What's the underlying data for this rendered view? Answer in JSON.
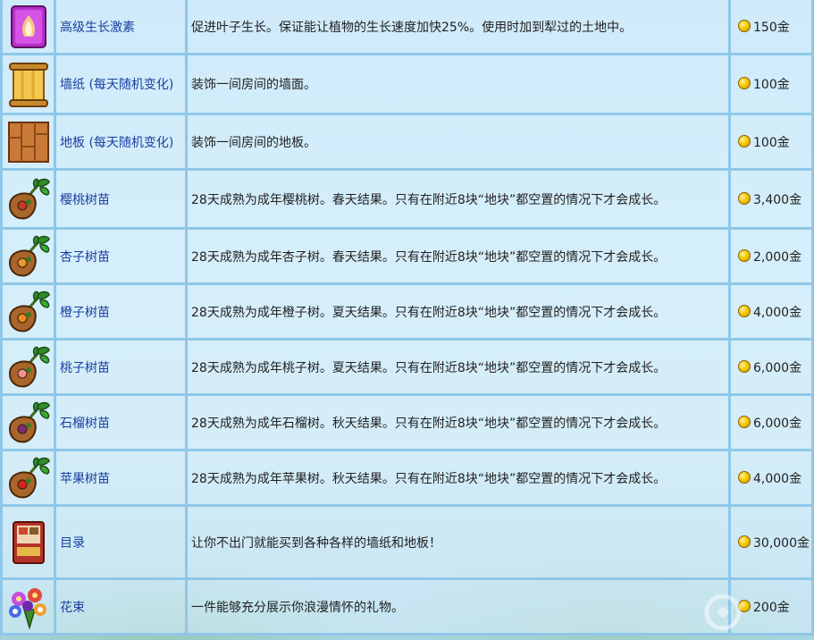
{
  "currency": "金",
  "rows": [
    {
      "icon": "deluxe-speed-gro-icon",
      "name": "高级生长激素",
      "desc": "促进叶子生长。保证能让植物的生长速度加快25%。使用时加到犁过的土地中。",
      "price": "150金"
    },
    {
      "icon": "wallpaper-scroll-icon",
      "name": "墙纸 (每天随机变化)",
      "desc": "装饰一间房间的墙面。",
      "price": "100金"
    },
    {
      "icon": "flooring-tile-icon",
      "name": "地板 (每天随机变化)",
      "desc": "装饰一间房间的地板。",
      "price": "100金"
    },
    {
      "icon": "sapling-icon",
      "name": "樱桃树苗",
      "desc": "28天成熟为成年樱桃树。春天结果。只有在附近8块“地块”都空置的情况下才会成长。",
      "price": "3,400金",
      "fruit": "#c0392b"
    },
    {
      "icon": "sapling-icon",
      "name": "杏子树苗",
      "desc": "28天成熟为成年杏子树。春天结果。只有在附近8块“地块”都空置的情况下才会成长。",
      "price": "2,000金",
      "fruit": "#e59b2e"
    },
    {
      "icon": "sapling-icon",
      "name": "橙子树苗",
      "desc": "28天成熟为成年橙子树。夏天结果。只有在附近8块“地块”都空置的情况下才会成长。",
      "price": "4,000金",
      "fruit": "#f08a1c"
    },
    {
      "icon": "sapling-icon",
      "name": "桃子树苗",
      "desc": "28天成熟为成年桃子树。夏天结果。只有在附近8块“地块”都空置的情况下才会成长。",
      "price": "6,000金",
      "fruit": "#f2918c"
    },
    {
      "icon": "sapling-icon",
      "name": "石榴树苗",
      "desc": "28天成熟为成年石榴树。秋天结果。只有在附近8块“地块”都空置的情况下才会成长。",
      "price": "6,000金",
      "fruit": "#7b2a7a"
    },
    {
      "icon": "sapling-icon",
      "name": "苹果树苗",
      "desc": "28天成熟为成年苹果树。秋天结果。只有在附近8块“地块”都空置的情况下才会成长。",
      "price": "4,000金",
      "fruit": "#d4261f"
    },
    {
      "icon": "catalogue-book-icon",
      "name": "目录",
      "desc": "让你不出门就能买到各种各样的墙纸和地板！",
      "price": "30,000金"
    },
    {
      "icon": "bouquet-icon",
      "name": "花束",
      "desc": "一件能够充分展示你浪漫情怀的礼物。",
      "price": "200金"
    }
  ]
}
